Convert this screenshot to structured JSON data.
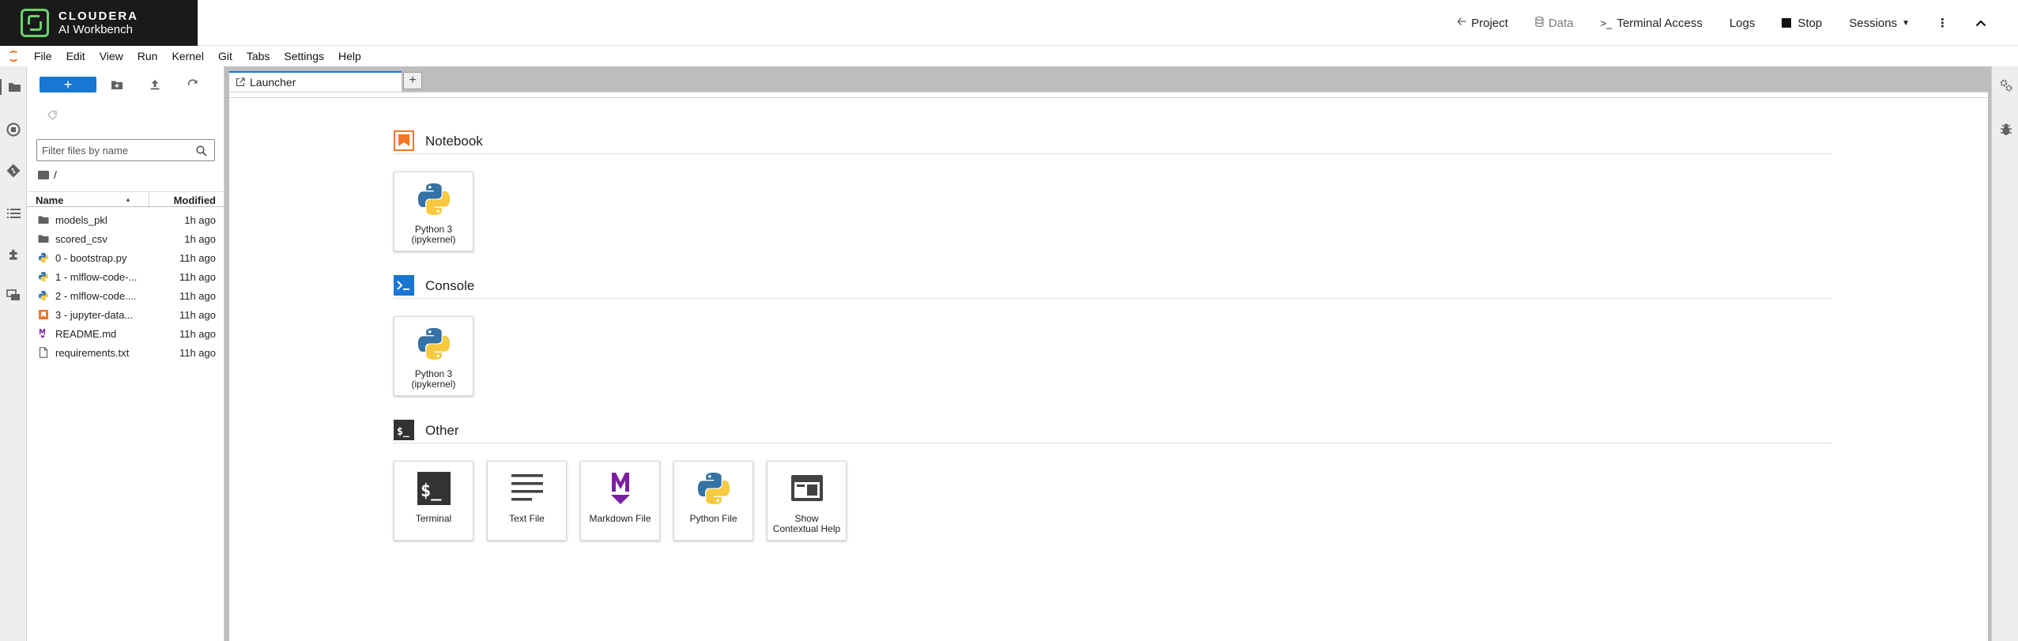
{
  "header": {
    "brand_name": "CLOUDERA",
    "brand_sub": "AI Workbench",
    "actions": {
      "project": "Project",
      "data": "Data",
      "terminal": "Terminal Access",
      "logs": "Logs",
      "stop": "Stop",
      "sessions": "Sessions"
    },
    "colors": {
      "brand_bg": "#1a1a1a",
      "logo_green": "#6bd26b"
    }
  },
  "menubar": {
    "items": [
      "File",
      "Edit",
      "View",
      "Run",
      "Kernel",
      "Git",
      "Tabs",
      "Settings",
      "Help"
    ]
  },
  "filebrowser": {
    "new_label": "+",
    "search_placeholder": "Filter files by name",
    "breadcrumb": "/",
    "col_name": "Name",
    "col_modified": "Modified",
    "files": [
      {
        "name": "models_pkl",
        "modified": "1h ago",
        "type": "folder"
      },
      {
        "name": "scored_csv",
        "modified": "1h ago",
        "type": "folder"
      },
      {
        "name": "0 - bootstrap.py",
        "modified": "11h ago",
        "type": "python"
      },
      {
        "name": "1 - mlflow-code-...",
        "modified": "11h ago",
        "type": "python"
      },
      {
        "name": "2 - mlflow-code....",
        "modified": "11h ago",
        "type": "python"
      },
      {
        "name": "3 - jupyter-data...",
        "modified": "11h ago",
        "type": "notebook"
      },
      {
        "name": "README.md",
        "modified": "11h ago",
        "type": "markdown"
      },
      {
        "name": "requirements.txt",
        "modified": "11h ago",
        "type": "text"
      }
    ]
  },
  "tabs": {
    "launcher_label": "Launcher",
    "add_label": "+"
  },
  "launcher": {
    "sections": {
      "notebook": "Notebook",
      "console": "Console",
      "other": "Other"
    },
    "notebook_cards": [
      {
        "line1": "Python 3",
        "line2": "(ipykernel)"
      }
    ],
    "console_cards": [
      {
        "line1": "Python 3",
        "line2": "(ipykernel)"
      }
    ],
    "other_cards": {
      "terminal": "Terminal",
      "text_file": "Text File",
      "markdown_file": "Markdown File",
      "python_file": "Python File",
      "help_line1": "Show",
      "help_line2": "Contextual Help"
    }
  }
}
